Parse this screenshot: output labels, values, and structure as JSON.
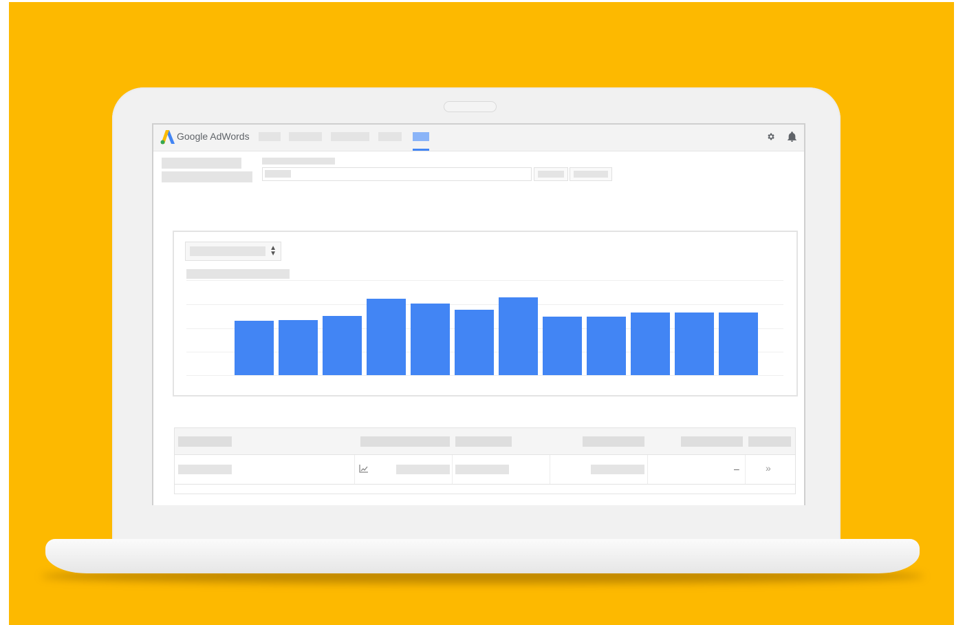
{
  "app": {
    "brand_name": "Google AdWords"
  },
  "toolbar": {
    "settings_icon": "gear-icon",
    "notifications_icon": "bell-icon"
  },
  "chart_card": {
    "select_icon": "sort-arrows-icon"
  },
  "table": {
    "row": {
      "trend_icon": "chart-trend-icon",
      "dash_value": "–",
      "expand_label": "»"
    }
  },
  "colors": {
    "background": "#fdb900",
    "accent": "#4285f4",
    "nav_active": "#8ab4f8"
  },
  "chart_data": {
    "type": "bar",
    "categories": [
      "",
      "",
      "",
      "",
      "",
      "",
      "",
      "",
      "",
      "",
      "",
      ""
    ],
    "values": [
      80,
      81,
      87,
      113,
      105,
      96,
      115,
      86,
      86,
      92,
      92,
      92
    ],
    "ylim": [
      0,
      140
    ],
    "grid": true,
    "legend": "none"
  }
}
